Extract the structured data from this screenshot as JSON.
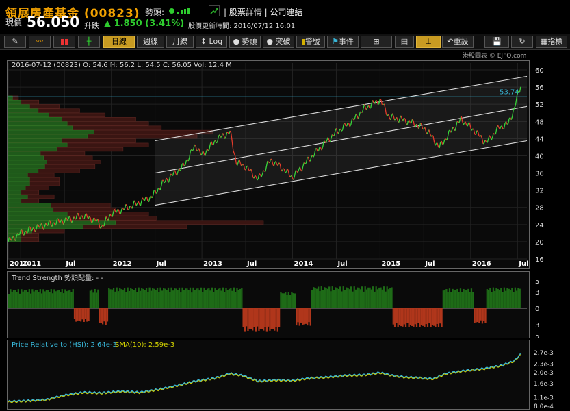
{
  "header": {
    "title": "領展房產基金 (00823)",
    "trend_label": "勢頭:",
    "links": "| 股票詳情 | 公司連結",
    "price_label": "現價",
    "price": "56.050",
    "change_label": "升跌",
    "change": "1.850 (3.41%)",
    "updated": "股價更新時間: 2016/07/12 16:01",
    "colors": {
      "up": "#2ecc2e",
      "title": "#f0a000"
    }
  },
  "toolbar": {
    "buttons": [
      "日線",
      "週線",
      "月線",
      "Log",
      "勢頭",
      "突破",
      "警號",
      "事件",
      "重設",
      "指標"
    ],
    "active": "日線"
  },
  "main_chart": {
    "info": "2016-07-12 (00823) O: 54.6  H: 56.2  L: 54.5  C: 56.05  Vol: 12.4 M",
    "watermark": "港股圖表 © EJFQ.com",
    "chart_data": {
      "type": "line",
      "title": "",
      "ylim": [
        16,
        60
      ],
      "y_ticks": [
        16,
        20,
        24,
        28,
        32,
        36,
        40,
        44,
        48,
        52,
        56,
        60
      ],
      "x_ticks": [
        "2010",
        "2011",
        "Jul",
        "2012",
        "Jul",
        "2013",
        "Jul",
        "2014",
        "Jul",
        "2015",
        "Jul",
        "2016",
        "Jul"
      ],
      "x_tick_pos": [
        0.0,
        0.2,
        0.9,
        1.65,
        2.35,
        3.1,
        3.8,
        4.55,
        5.25,
        5.95,
        6.65,
        7.4,
        8.15
      ],
      "x_range": [
        0,
        8.3
      ],
      "close": [
        [
          0.0,
          20.0
        ],
        [
          0.2,
          22.0
        ],
        [
          0.5,
          23.5
        ],
        [
          0.9,
          25.0
        ],
        [
          1.2,
          26.0
        ],
        [
          1.4,
          25.0
        ],
        [
          1.5,
          23.5
        ],
        [
          1.65,
          26.5
        ],
        [
          2.0,
          28.5
        ],
        [
          2.3,
          30.5
        ],
        [
          2.5,
          34.0
        ],
        [
          2.8,
          37.5
        ],
        [
          3.0,
          42.5
        ],
        [
          3.1,
          40.0
        ],
        [
          3.35,
          44.0
        ],
        [
          3.55,
          45.5
        ],
        [
          3.65,
          38.5
        ],
        [
          3.8,
          37.5
        ],
        [
          4.0,
          34.5
        ],
        [
          4.2,
          39.0
        ],
        [
          4.4,
          37.0
        ],
        [
          4.55,
          35.0
        ],
        [
          4.8,
          39.0
        ],
        [
          5.0,
          42.0
        ],
        [
          5.25,
          45.5
        ],
        [
          5.5,
          48.0
        ],
        [
          5.7,
          51.0
        ],
        [
          5.95,
          53.0
        ],
        [
          6.1,
          49.0
        ],
        [
          6.3,
          48.5
        ],
        [
          6.5,
          47.5
        ],
        [
          6.7,
          46.0
        ],
        [
          6.9,
          42.0
        ],
        [
          7.1,
          46.0
        ],
        [
          7.25,
          48.5
        ],
        [
          7.45,
          46.0
        ],
        [
          7.65,
          43.0
        ],
        [
          7.85,
          46.5
        ],
        [
          8.0,
          47.5
        ],
        [
          8.1,
          51.0
        ],
        [
          8.15,
          54.0
        ],
        [
          8.2,
          56.05
        ]
      ],
      "channel": {
        "x": [
          2.35,
          8.3
        ],
        "upper": [
          43.5,
          58.5
        ],
        "middle": [
          36.0,
          51.5
        ],
        "lower": [
          28.5,
          43.5
        ]
      },
      "hline": {
        "value": 53.74,
        "label": "53.74",
        "color": "#38b6d8"
      },
      "volume_profile": [
        {
          "price": 20.5,
          "len": 0.12
        },
        {
          "price": 21.5,
          "len": 0.12
        },
        {
          "price": 22.5,
          "len": 0.22
        },
        {
          "price": 23.5,
          "len": 0.7
        },
        {
          "price": 24.5,
          "len": 1.0
        },
        {
          "price": 25.5,
          "len": 0.58
        },
        {
          "price": 26.5,
          "len": 0.55
        },
        {
          "price": 27.5,
          "len": 0.42
        },
        {
          "price": 28.5,
          "len": 0.4
        },
        {
          "price": 29.5,
          "len": 0.12
        },
        {
          "price": 30.5,
          "len": 0.18
        },
        {
          "price": 31.5,
          "len": 0.12
        },
        {
          "price": 32.5,
          "len": 0.16
        },
        {
          "price": 33.5,
          "len": 0.2
        },
        {
          "price": 34.5,
          "len": 0.2
        },
        {
          "price": 35.5,
          "len": 0.18
        },
        {
          "price": 36.5,
          "len": 0.28
        },
        {
          "price": 37.5,
          "len": 0.34
        },
        {
          "price": 38.5,
          "len": 0.36
        },
        {
          "price": 39.5,
          "len": 0.33
        },
        {
          "price": 40.5,
          "len": 0.3
        },
        {
          "price": 41.5,
          "len": 0.45
        },
        {
          "price": 42.5,
          "len": 0.55
        },
        {
          "price": 43.5,
          "len": 0.5
        },
        {
          "price": 44.5,
          "len": 0.74
        },
        {
          "price": 45.5,
          "len": 0.8
        },
        {
          "price": 46.5,
          "len": 0.6
        },
        {
          "price": 47.5,
          "len": 0.55
        },
        {
          "price": 48.5,
          "len": 0.5
        },
        {
          "price": 49.5,
          "len": 0.38
        },
        {
          "price": 50.5,
          "len": 0.28
        },
        {
          "price": 51.5,
          "len": 0.2
        },
        {
          "price": 52.5,
          "len": 0.12
        },
        {
          "price": 53.5,
          "len": 0.04
        }
      ]
    }
  },
  "trend_panel": {
    "title": "Trend Strength 勢頭配量: - -",
    "chart_data": {
      "type": "bar",
      "ylim": [
        -5,
        5
      ],
      "y_ticks": [
        "5",
        "3",
        "0",
        "3",
        "5"
      ],
      "x_range": [
        0,
        8.3
      ],
      "segments": [
        [
          0.0,
          1.05,
          3.5
        ],
        [
          1.05,
          1.3,
          -2.5
        ],
        [
          1.3,
          1.45,
          3.5
        ],
        [
          1.45,
          1.6,
          -3.0
        ],
        [
          1.6,
          3.75,
          3.8
        ],
        [
          3.75,
          4.35,
          -4.2
        ],
        [
          4.35,
          4.6,
          3.0
        ],
        [
          4.6,
          4.85,
          -3.2
        ],
        [
          4.85,
          6.15,
          4.0
        ],
        [
          6.15,
          6.95,
          -3.5
        ],
        [
          6.95,
          7.45,
          3.6
        ],
        [
          7.45,
          7.65,
          -2.8
        ],
        [
          7.65,
          8.2,
          3.8
        ]
      ]
    }
  },
  "relative_panel": {
    "title": "Price Relative to (HSI): 2.64e-3",
    "sma_label": "SMA(10): 2.59e-3",
    "chart_data": {
      "type": "line",
      "ylim": [
        0.0008,
        0.0028
      ],
      "y_ticks": [
        "2.7e-3",
        "2.3e-3",
        "2.0e-3",
        "1.6e-3",
        "1.1e-3",
        "8.0e-4"
      ],
      "x_range": [
        0,
        8.3
      ],
      "series": [
        [
          0.0,
          0.00095
        ],
        [
          0.3,
          0.00098
        ],
        [
          0.6,
          0.00102
        ],
        [
          0.9,
          0.00118
        ],
        [
          1.2,
          0.00128
        ],
        [
          1.5,
          0.00126
        ],
        [
          1.8,
          0.00132
        ],
        [
          2.1,
          0.00128
        ],
        [
          2.4,
          0.00138
        ],
        [
          2.7,
          0.00152
        ],
        [
          3.0,
          0.00168
        ],
        [
          3.3,
          0.00178
        ],
        [
          3.55,
          0.00195
        ],
        [
          3.75,
          0.00188
        ],
        [
          4.0,
          0.00168
        ],
        [
          4.3,
          0.00172
        ],
        [
          4.55,
          0.0017
        ],
        [
          4.8,
          0.00178
        ],
        [
          5.1,
          0.00182
        ],
        [
          5.4,
          0.00188
        ],
        [
          5.7,
          0.0019
        ],
        [
          5.95,
          0.00198
        ],
        [
          6.15,
          0.00188
        ],
        [
          6.35,
          0.00182
        ],
        [
          6.55,
          0.0018
        ],
        [
          6.8,
          0.00176
        ],
        [
          7.0,
          0.00195
        ],
        [
          7.3,
          0.00205
        ],
        [
          7.6,
          0.00212
        ],
        [
          7.9,
          0.00224
        ],
        [
          8.1,
          0.0024
        ],
        [
          8.2,
          0.00264
        ]
      ]
    }
  }
}
